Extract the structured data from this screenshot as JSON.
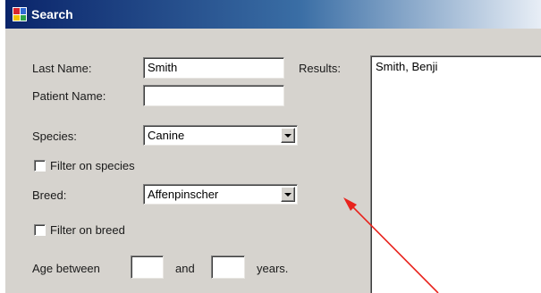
{
  "window": {
    "title": "Search",
    "icon": "form-window-icon"
  },
  "form": {
    "last_name": {
      "label": "Last Name:",
      "value": "Smith"
    },
    "patient_name": {
      "label": "Patient Name:",
      "value": ""
    },
    "species": {
      "label": "Species:",
      "selected": "Canine"
    },
    "filter_species": {
      "label": "Filter on species",
      "checked": false
    },
    "breed": {
      "label": "Breed:",
      "selected": "Affenpinscher"
    },
    "filter_breed": {
      "label": "Filter on breed",
      "checked": false
    },
    "age": {
      "label_before": "Age between",
      "label_and": "and",
      "label_after": "years.",
      "min": "",
      "max": ""
    }
  },
  "results": {
    "label": "Results:",
    "items": [
      "Smith, Benji"
    ]
  },
  "annotation": {
    "arrow_color": "#e8231d"
  },
  "colors": {
    "title_bar": "#0a246a",
    "dialog_bg": "#d6d3ce"
  }
}
